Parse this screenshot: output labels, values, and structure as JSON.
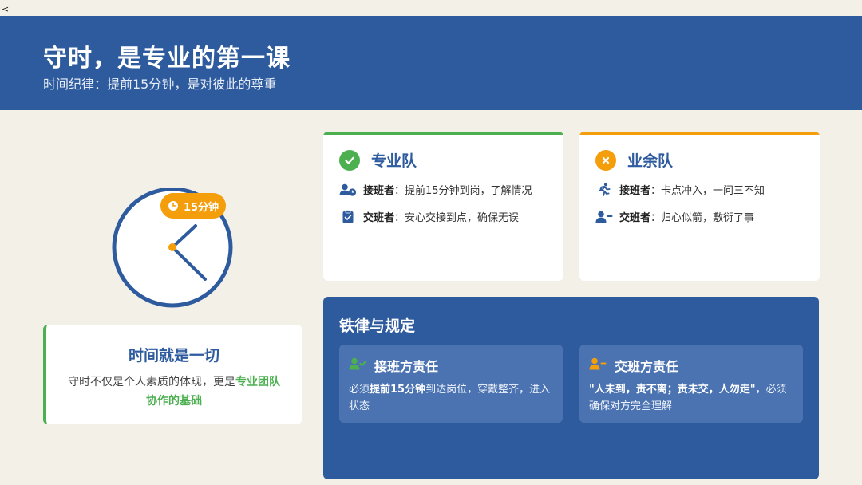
{
  "corner_glyph": "<",
  "header": {
    "title": "守时，是专业的第一课",
    "subtitle": "时间纪律：提前15分钟，是对彼此的尊重"
  },
  "clock": {
    "badge_label": "15分钟",
    "colors": {
      "ring": "#2e5b9e",
      "badge": "#f59e0b",
      "center": "#f59e0b"
    }
  },
  "time_card": {
    "title": "时间就是一切",
    "body_prefix": "守时不仅是个人素质的体现，更是",
    "body_highlight": "专业团队协作的基础"
  },
  "teams": {
    "pro": {
      "title": "专业队",
      "icon": "check-circle-icon",
      "accent": "#4caf50",
      "rows": [
        {
          "icon": "user-clock-icon",
          "role": "接班者",
          "text": "：提前15分钟到岗，了解情况"
        },
        {
          "icon": "clipboard-check-icon",
          "role": "交班者",
          "text": "：安心交接到点，确保无误"
        }
      ]
    },
    "amateur": {
      "title": "业余队",
      "icon": "x-circle-icon",
      "accent": "#f59e0b",
      "rows": [
        {
          "icon": "running-person-icon",
          "role": "接班者",
          "text": "：卡点冲入，一问三不知"
        },
        {
          "icon": "user-minus-icon",
          "role": "交班者",
          "text": "：归心似箭，敷衍了事"
        }
      ]
    }
  },
  "rules": {
    "title": "铁律与规定",
    "take_over": {
      "icon": "user-check-icon",
      "title": "接班方责任",
      "body_prefix": "必须",
      "body_bold": "提前15分钟",
      "body_suffix": "到达岗位，穿戴整齐，进入状态"
    },
    "hand_over": {
      "icon": "user-minus-icon",
      "title": "交班方责任",
      "body_bold": "\"人未到，责不离；责未交，人勿走\"",
      "body_suffix": "，必须确保对方完全理解"
    }
  }
}
